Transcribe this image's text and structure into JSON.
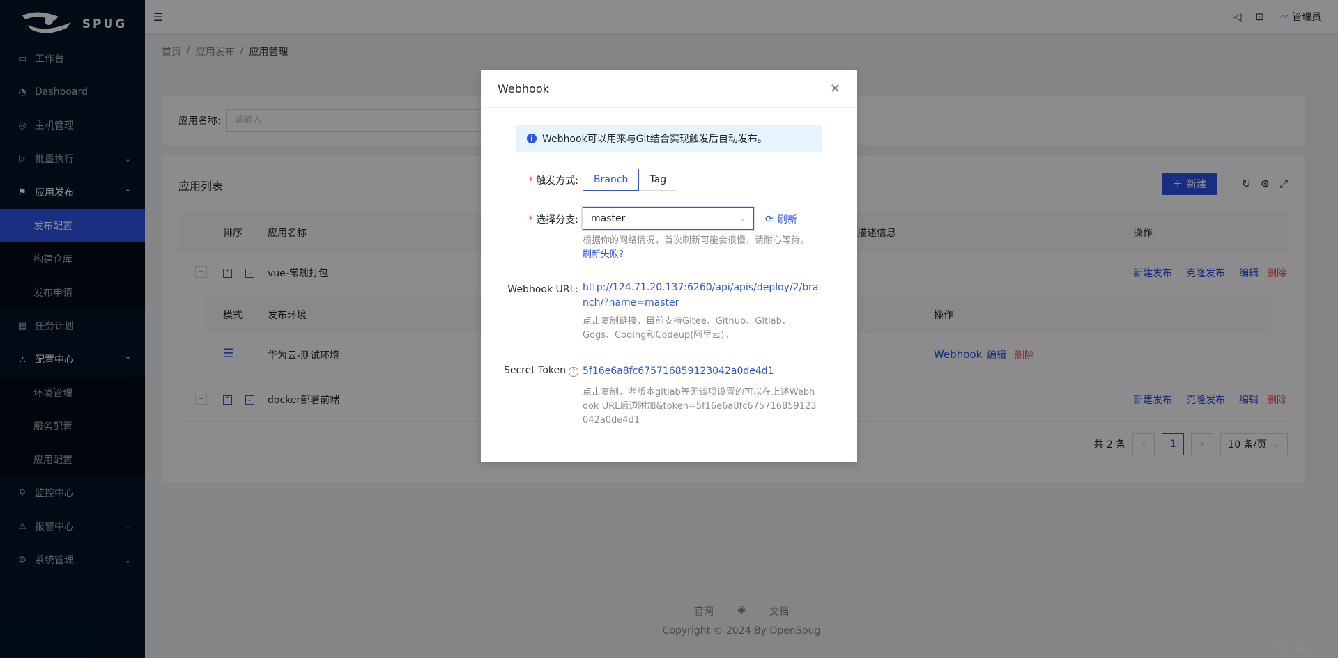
{
  "app": {
    "logo_text": "SPUG"
  },
  "sidebar": {
    "items": [
      {
        "label": "工作台",
        "icon": "desktop-icon"
      },
      {
        "label": "Dashboard",
        "icon": "dashboard-icon"
      },
      {
        "label": "主机管理",
        "icon": "cloud-server-icon"
      },
      {
        "label": "批量执行",
        "icon": "code-icon"
      },
      {
        "label": "应用发布",
        "icon": "flag-icon"
      },
      {
        "label": "任务计划",
        "icon": "schedule-icon"
      },
      {
        "label": "配置中心",
        "icon": "deployment-icon"
      },
      {
        "label": "监控中心",
        "icon": "monitor-icon"
      },
      {
        "label": "报警中心",
        "icon": "alert-icon"
      },
      {
        "label": "系统管理",
        "icon": "setting-icon"
      }
    ],
    "deploy_sub": [
      "发布配置",
      "构建仓库",
      "发布申请"
    ],
    "config_sub": [
      "环境管理",
      "服务配置",
      "应用配置"
    ]
  },
  "header": {
    "user": "管理员"
  },
  "breadcrumb": [
    "首页",
    "应用发布",
    "应用管理"
  ],
  "search": {
    "label": "应用名称:",
    "placeholder": "请输入"
  },
  "table": {
    "title": "应用列表",
    "new_button": "新建",
    "columns": {
      "sort": "排序",
      "name": "应用名称",
      "desc": "描述信息",
      "ops": "操作"
    },
    "sub_columns": {
      "mode": "模式",
      "env": "发布环境",
      "ops": "操作"
    },
    "rows": [
      {
        "expand": "−",
        "name": "vue-常规打包",
        "actions": [
          "新建发布",
          "克隆发布",
          "编辑",
          "删除"
        ]
      },
      {
        "expand": "+",
        "name": "docker部署前端",
        "actions": [
          "新建发布",
          "克隆发布",
          "编辑",
          "删除"
        ]
      }
    ],
    "sub_row": {
      "env": "华为云-测试环境",
      "actions": [
        "Webhook",
        "编辑",
        "删除"
      ]
    },
    "pagination": {
      "total": "共 2 条",
      "current": "1",
      "page_size": "10 条/页"
    }
  },
  "footer": {
    "links": [
      "官网",
      "文档"
    ],
    "copyright": "Copyright © 2024 By OpenSpug"
  },
  "watermark": "CSDN @zjj224",
  "modal": {
    "title": "Webhook",
    "alert": "Webhook可以用来与Git结合实现触发后自动发布。",
    "trigger_label": "触发方式:",
    "trigger_options": [
      "Branch",
      "Tag"
    ],
    "branch_label": "选择分支:",
    "branch_value": "master",
    "refresh": "刷新",
    "branch_help": "根据你的网络情况，首次刷新可能会很慢，请耐心等待。",
    "refresh_failed": "刷新失败?",
    "url_label": "Webhook URL:",
    "url_value": "http://124.71.20.137:6260/api/apis/deploy/2/branch/?name=master",
    "url_help": "点击复制链接，目前支持Gitee、Github、Gitlab、Gogs、Coding和Codeup(阿里云)。",
    "token_label": "Secret Token",
    "token_value": "5f16e6a8fc675716859123042a0de4d1",
    "token_help": "点击复制，老版本gitlab等无该项设置的可以在上述Webhook URL后边附加&token=5f16e6a8fc675716859123042a0de4d1"
  }
}
